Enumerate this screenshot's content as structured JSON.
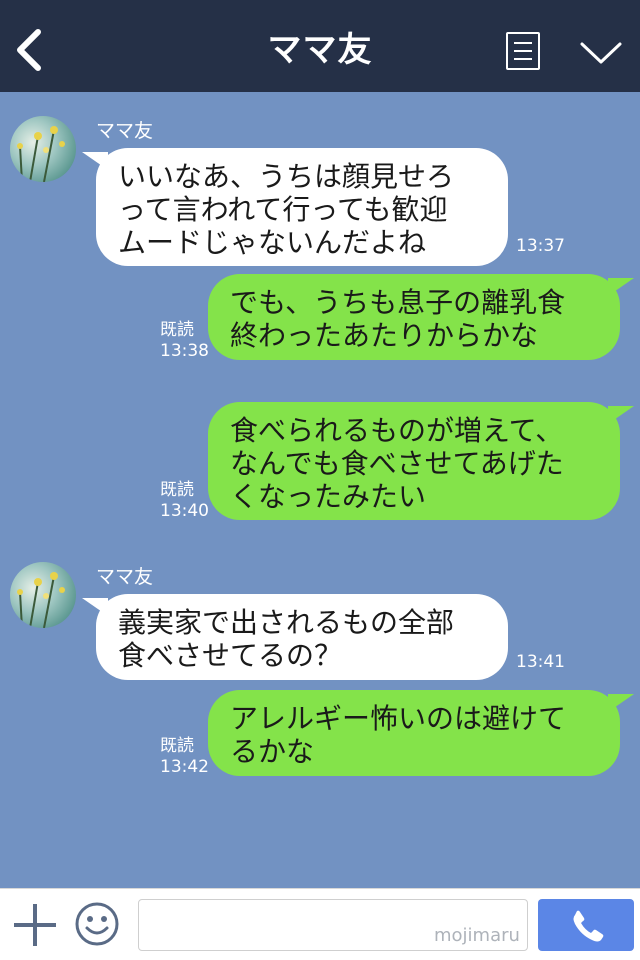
{
  "header": {
    "title": "ママ友",
    "back_icon": "chevron-left-icon",
    "menu_icon": "note-list-icon",
    "expand_icon": "chevron-down-icon"
  },
  "messages": [
    {
      "direction": "in",
      "sender": "ママ友",
      "lines": [
        "いいなあ、うちは顔見せろ",
        "って言われて行っても歓迎",
        "ムードじゃないんだよね"
      ],
      "time": "13:37"
    },
    {
      "direction": "out",
      "read": "既読",
      "lines": [
        "でも、うちも息子の離乳食",
        "終わったあたりからかな"
      ],
      "time": "13:38"
    },
    {
      "direction": "out",
      "read": "既読",
      "lines": [
        "食べられるものが増えて、",
        "なんでも食べさせてあげた",
        "くなったみたい"
      ],
      "time": "13:40"
    },
    {
      "direction": "in",
      "sender": "ママ友",
      "lines": [
        "義実家で出されるもの全部",
        "食べさせてるの？"
      ],
      "time": "13:41"
    },
    {
      "direction": "out",
      "read": "既読",
      "lines": [
        "アレルギー怖いのは避けて",
        "るかな"
      ],
      "time": "13:42"
    }
  ],
  "footer": {
    "input_value": "",
    "watermark": "mojimaru",
    "plus_icon": "plus-icon",
    "emoji_icon": "smiley-icon",
    "call_icon": "phone-icon"
  },
  "colors": {
    "header_bg": "#253047",
    "chat_bg": "#7292c2",
    "incoming_bubble": "#ffffff",
    "outgoing_bubble": "#84e34a",
    "call_button": "#5b86e6"
  }
}
